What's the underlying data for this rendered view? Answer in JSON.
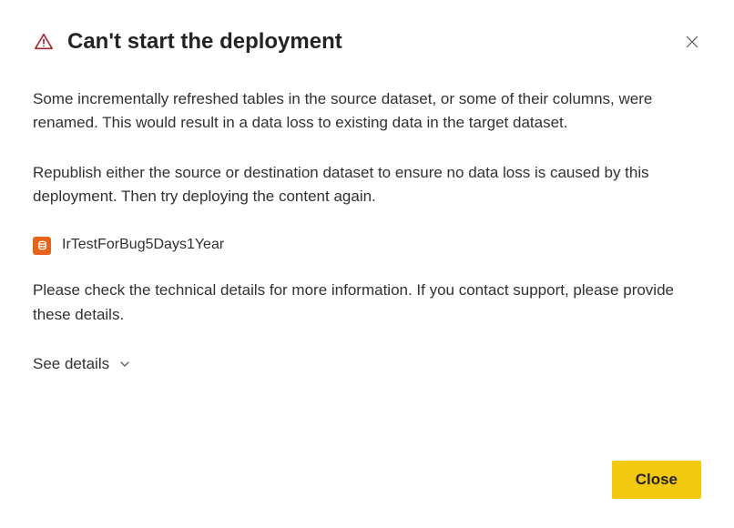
{
  "dialog": {
    "title": "Can't start the deployment",
    "body_text_1": "Some incrementally refreshed tables in the source dataset, or some of their columns, were renamed. This would result in a data loss to existing data in the target dataset.",
    "body_text_2": "Republish either the source or destination dataset to ensure no data loss is caused by this deployment. Then try deploying the content again.",
    "dataset_name": "IrTestForBug5Days1Year",
    "body_text_3": "Please check the technical details for more information. If you contact support, please provide these details.",
    "see_details_label": "See details",
    "close_button_label": "Close"
  },
  "colors": {
    "warning_red": "#a4262c",
    "dataset_orange": "#e8631a",
    "primary_yellow": "#f2c811"
  }
}
